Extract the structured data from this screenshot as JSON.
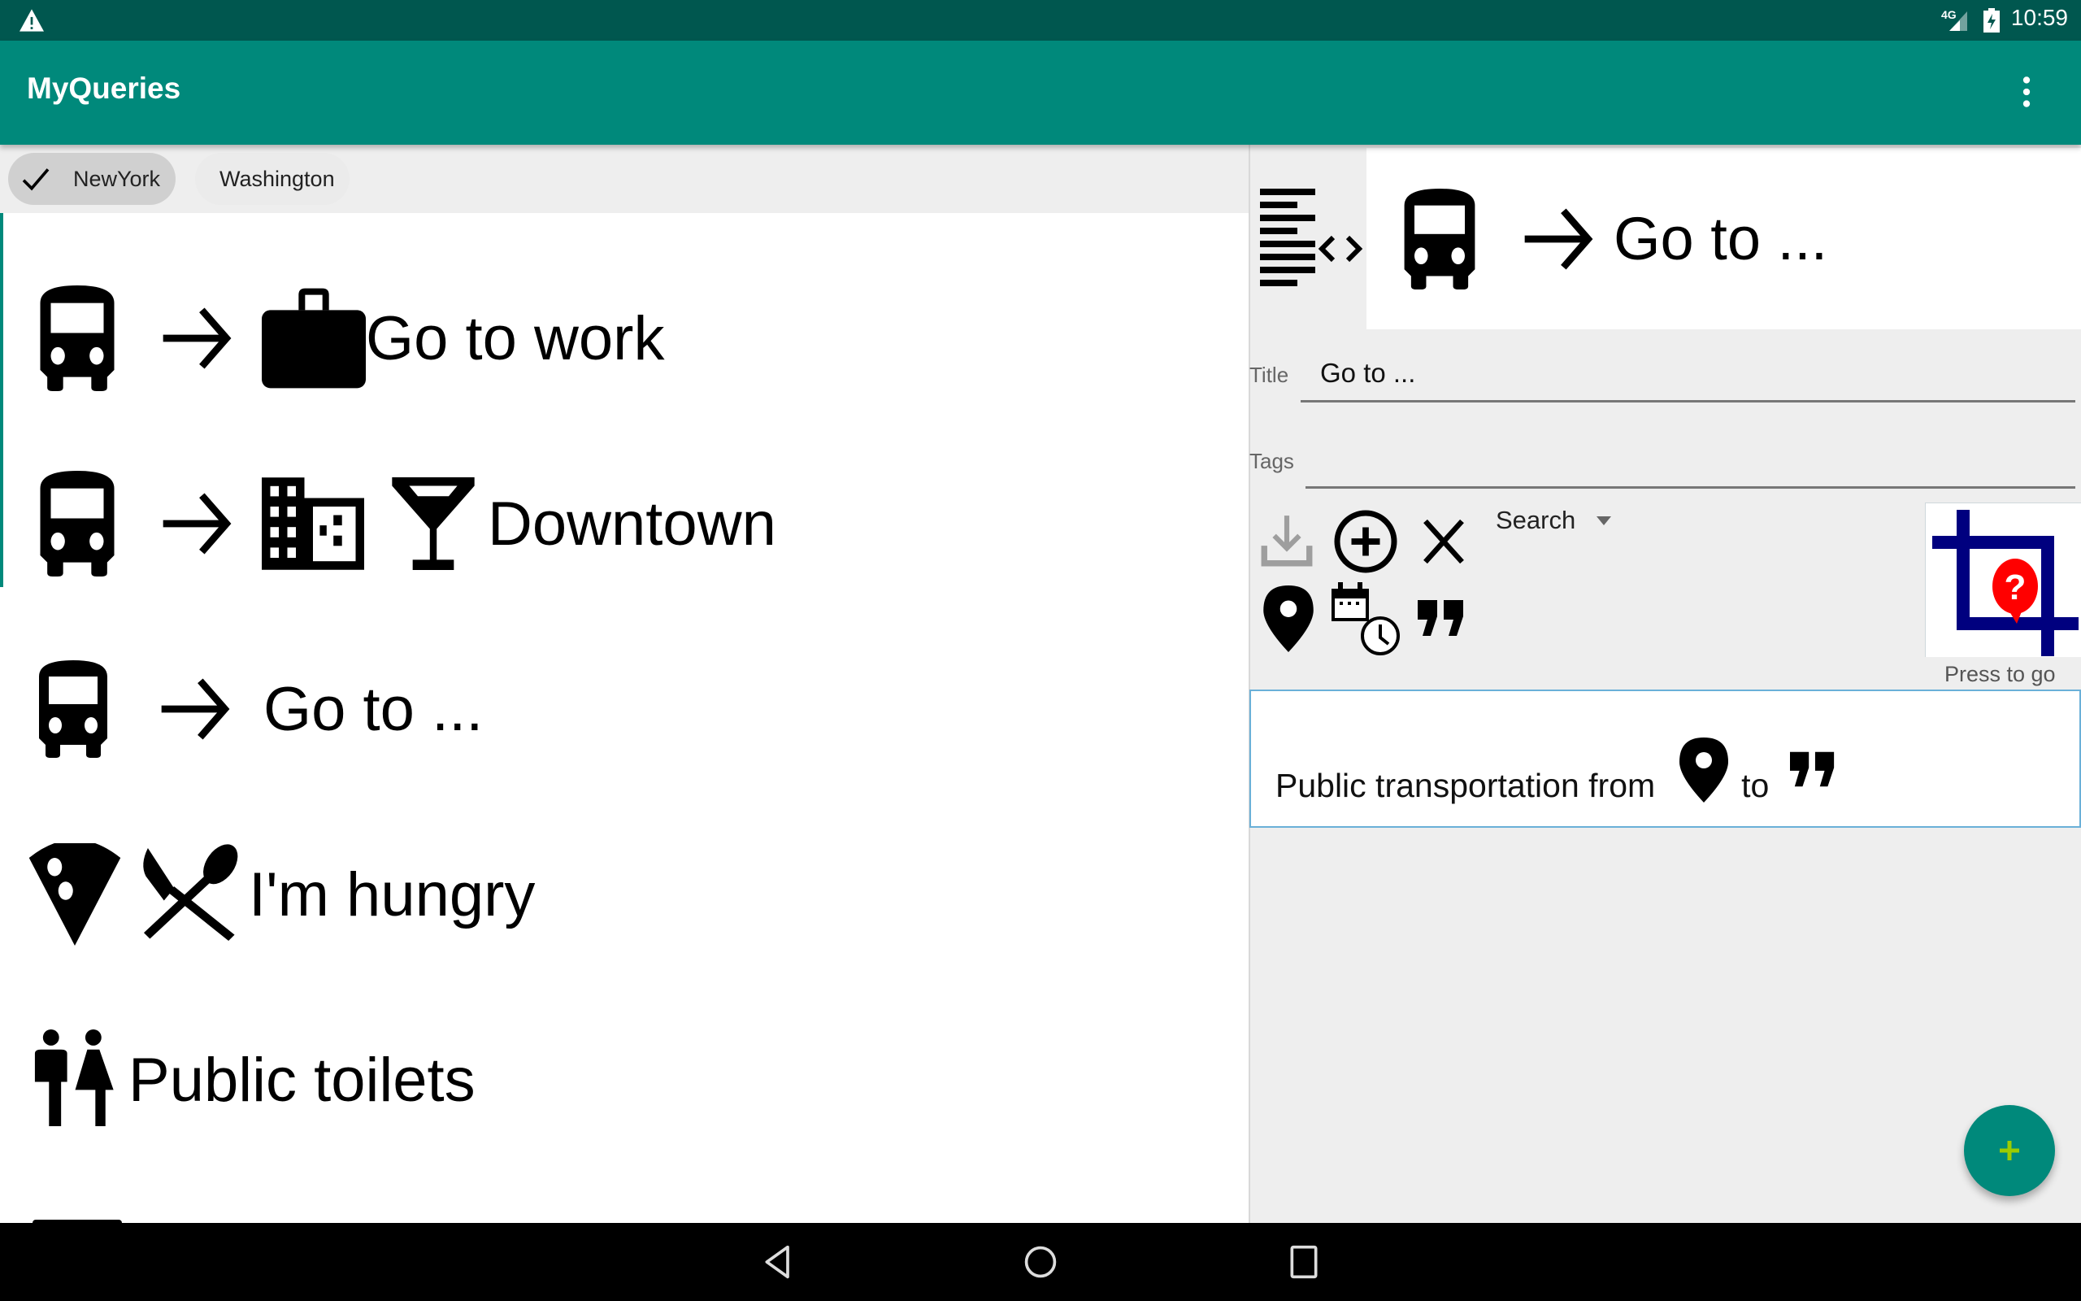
{
  "status_bar": {
    "warning_icon": "warning-triangle-icon",
    "network_label": "4G",
    "time": "10:59"
  },
  "app_bar": {
    "title": "MyQueries",
    "overflow_icon": "more-vert-icon"
  },
  "colors": {
    "primary": "#00897b",
    "primary_dark": "#00574f",
    "fab_plus": "#9ccc00",
    "result_border": "#6ab0d8",
    "crop_blue": "#00007f",
    "help_red": "#ff0000"
  },
  "chips": [
    {
      "label": "NewYork",
      "selected": true,
      "icon": "check-icon"
    },
    {
      "label": "Washington",
      "selected": false
    }
  ],
  "queries": [
    {
      "icons": [
        "bus-icon",
        "arrow-right-icon",
        "briefcase-icon"
      ],
      "title": "Go to work"
    },
    {
      "icons": [
        "bus-icon",
        "arrow-right-icon",
        "city-buildings-icon",
        "cocktail-icon"
      ],
      "title": "Downtown"
    },
    {
      "icons": [
        "bus-icon",
        "arrow-right-icon"
      ],
      "title": "Go to ..."
    },
    {
      "icons": [
        "pizza-slice-icon",
        "knife-spoon-icon"
      ],
      "title": "I'm hungry"
    },
    {
      "icons": [
        "toilets-man-woman-icon"
      ],
      "title": "Public toilets"
    }
  ],
  "editor": {
    "preview": {
      "icons": [
        "code-view-icon",
        "bus-icon",
        "arrow-right-icon"
      ],
      "title": "Go to ..."
    },
    "title_label": "Title",
    "title_value": "Go to ...",
    "tags_label": "Tags",
    "tags_value": "",
    "tools_row1": [
      "download-icon",
      "add-circle-icon",
      "close-icon"
    ],
    "tools_row2": [
      "location-pin-icon",
      "calendar-clock-icon",
      "quote-icon"
    ],
    "search_dropdown": "Search",
    "image_button_caption": "Press to go",
    "result": {
      "text_before": "Public transportation from",
      "text_middle": "to",
      "icons": [
        "location-pin-icon",
        "quote-icon"
      ]
    }
  },
  "fab": {
    "icon": "plus-icon"
  },
  "nav_bar": {
    "buttons": [
      "back-icon",
      "home-icon",
      "recents-icon"
    ]
  }
}
